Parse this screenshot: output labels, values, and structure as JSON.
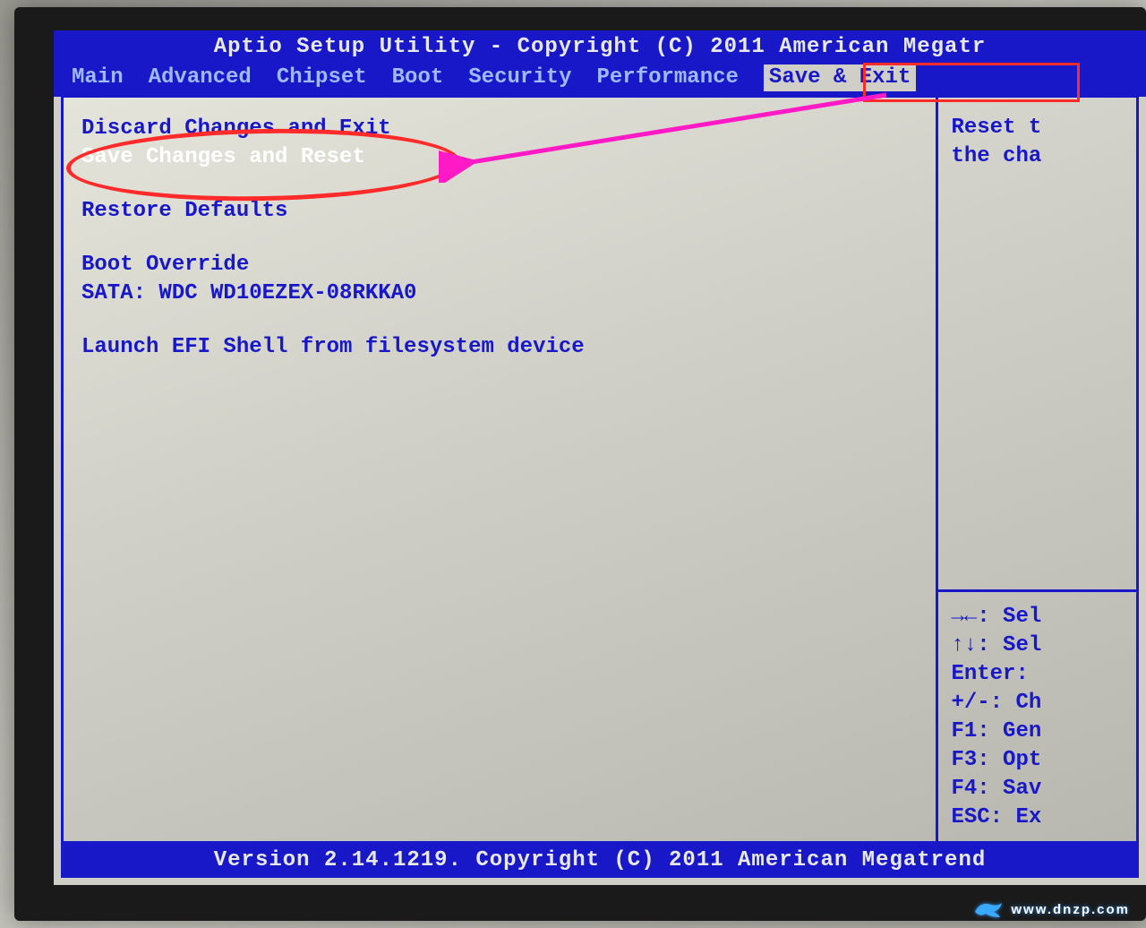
{
  "header": {
    "title": "Aptio Setup Utility - Copyright (C) 2011 American Megatr"
  },
  "tabs": [
    "Main",
    "Advanced",
    "Chipset",
    "Boot",
    "Security",
    "Performance",
    "Save & Exit"
  ],
  "active_tab_index": 6,
  "menu": {
    "discard": "Discard Changes and Exit",
    "save_reset": "Save Changes and Reset",
    "restore": "Restore Defaults",
    "boot_override_header": "Boot Override",
    "boot_device": "SATA: WDC WD10EZEX-08RKKA0",
    "launch_efi": "Launch EFI Shell from filesystem device"
  },
  "help_desc": {
    "line1": "Reset t",
    "line2": "the cha"
  },
  "help_keys": [
    "→←: Sel",
    "↑↓: Sel",
    "Enter: ",
    "+/-: Ch",
    "F1: Gen",
    "F3: Opt",
    "F4: Sav",
    "ESC: Ex"
  ],
  "footer": "Version 2.14.1219. Copyright (C) 2011 American Megatrend",
  "watermark_text": "www.dnzp.com",
  "colors": {
    "bios_blue": "#1818c8",
    "bios_bg": "#cfcfc8",
    "annotation_red": "#ff2a2a",
    "annotation_magenta": "#ff1ac6"
  }
}
